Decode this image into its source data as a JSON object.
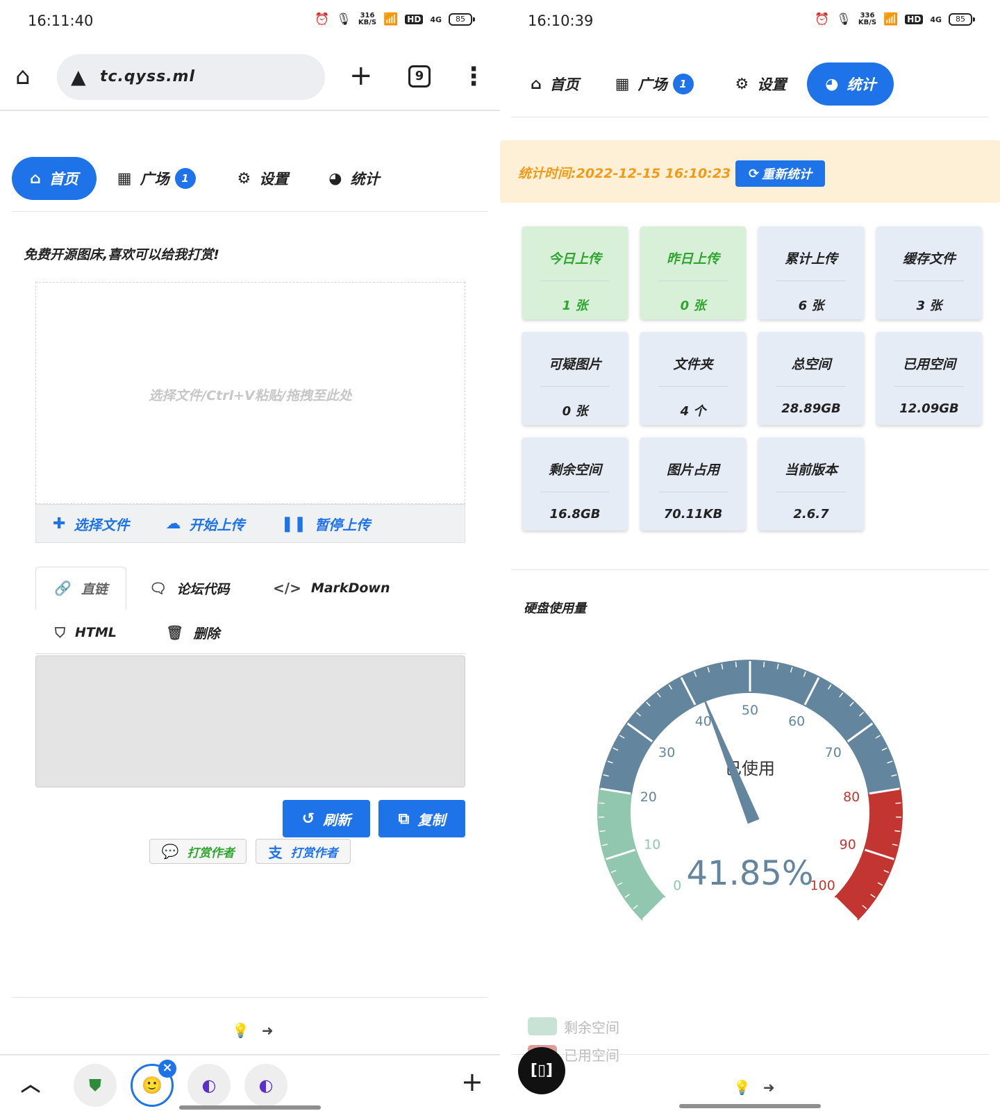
{
  "left": {
    "status": {
      "time": "16:11:40",
      "speed_top": "316",
      "speed_bottom": "KB/S",
      "hd": "HD",
      "net": "4G",
      "battery": "85"
    },
    "browser": {
      "url": "tc.qyss.ml",
      "tab_count": "9"
    },
    "nav": [
      {
        "label": "首页",
        "icon": "home-icon",
        "active": true
      },
      {
        "label": "广场",
        "icon": "grid-icon",
        "badge": "1"
      },
      {
        "label": "设置",
        "icon": "gears-icon"
      },
      {
        "label": "统计",
        "icon": "pie-chart-icon"
      }
    ],
    "promo": "免费开源图床,喜欢可以给我打赏!",
    "dropzone_hint": "选择文件/Ctrl+V粘贴/拖拽至此处",
    "upload_buttons": [
      "选择文件",
      "开始上传",
      "暂停上传"
    ],
    "link_tabs": [
      "直链",
      "论坛代码",
      "MarkDown",
      "HTML",
      "删除"
    ],
    "buttons": {
      "refresh": "刷新",
      "copy": "复制"
    },
    "tips": [
      "打赏作者",
      "打赏作者"
    ]
  },
  "right": {
    "status": {
      "time": "16:10:39",
      "speed_top": "336",
      "speed_bottom": "KB/S",
      "hd": "HD",
      "net": "4G",
      "battery": "85"
    },
    "nav": [
      {
        "label": "首页",
        "icon": "home-icon"
      },
      {
        "label": "广场",
        "icon": "grid-icon",
        "badge": "1"
      },
      {
        "label": "设置",
        "icon": "gears-icon"
      },
      {
        "label": "统计",
        "icon": "pie-chart-icon",
        "active": true
      }
    ],
    "stat_time": "统计时间:2022-12-15 16:10:23",
    "restat_label": "重新统计",
    "cards": [
      {
        "label": "今日上传",
        "value": "1 张",
        "green": true
      },
      {
        "label": "昨日上传",
        "value": "0 张",
        "green": true
      },
      {
        "label": "累计上传",
        "value": "6 张"
      },
      {
        "label": "缓存文件",
        "value": "3 张"
      },
      {
        "label": "可疑图片",
        "value": "0 张"
      },
      {
        "label": "文件夹",
        "value": "4 个"
      },
      {
        "label": "总空间",
        "value": "28.89GB"
      },
      {
        "label": "已用空间",
        "value": "12.09GB"
      },
      {
        "label": "剩余空间",
        "value": "16.8GB"
      },
      {
        "label": "图片占用",
        "value": "70.11KB"
      },
      {
        "label": "当前版本",
        "value": "2.6.7"
      }
    ],
    "disk_title": "硬盘使用量",
    "legend": [
      {
        "label": "剩余空间",
        "color": "#92c7ac"
      },
      {
        "label": "已用空间",
        "color": "#c23531"
      }
    ]
  },
  "chart_data": {
    "type": "gauge",
    "title": "已使用",
    "value": 41.85,
    "value_label": "41.85%",
    "min": 0,
    "max": 100,
    "tick_labels": [
      "0",
      "10",
      "20",
      "30",
      "40",
      "50",
      "60",
      "70",
      "80",
      "90",
      "100"
    ],
    "bands": [
      {
        "from": 0,
        "to": 20,
        "color": "#91c7ae"
      },
      {
        "from": 20,
        "to": 80,
        "color": "#63869e"
      },
      {
        "from": 80,
        "to": 100,
        "color": "#c23531"
      }
    ]
  }
}
